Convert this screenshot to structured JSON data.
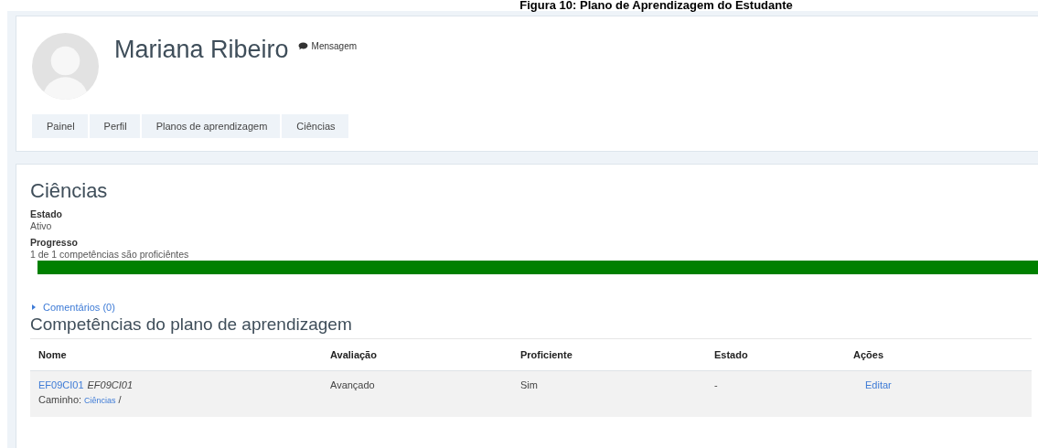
{
  "caption": "Figura 10: Plano de Aprendizagem do Estudante",
  "profile": {
    "name": "Mariana Ribeiro",
    "message_link": "Mensagem"
  },
  "breadcrumb": [
    {
      "label": "Painel"
    },
    {
      "label": "Perfil"
    },
    {
      "label": "Planos de aprendizagem"
    },
    {
      "label": "Ciências"
    }
  ],
  "plan": {
    "title": "Ciências",
    "state_label": "Estado",
    "state_value": "Ativo",
    "progress_label": "Progresso",
    "progress_text": "1 de 1 competências são proficiêntes",
    "level": 1
  },
  "comments": {
    "label": "Comentários (0)",
    "expanded": false
  },
  "competencies": {
    "title": "Competências do plano de aprendizagem",
    "columns": [
      "Nome",
      "Avaliação",
      "Proficiente",
      "Estado",
      "Ações"
    ],
    "rows": [
      {
        "code_link": "EF09CI01",
        "code_italic": "EF09CI01",
        "path_label": "Caminho:",
        "path_link": "Ciências",
        "path_sep": "/",
        "rating": "Avançado",
        "proficient": "Sim",
        "state": "-",
        "action": "Editar"
      }
    ]
  }
}
